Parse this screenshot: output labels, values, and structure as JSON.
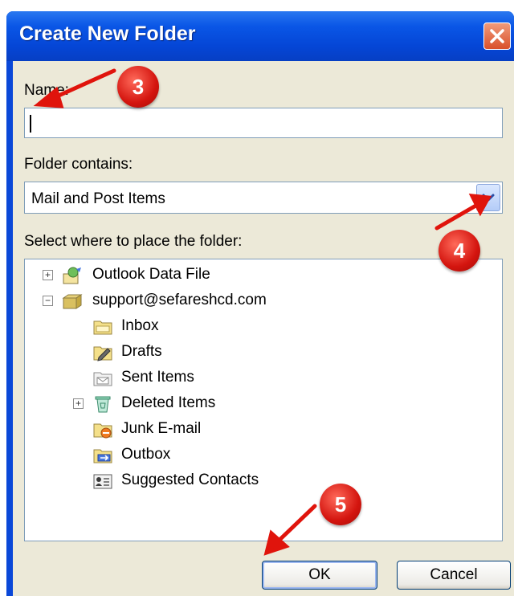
{
  "dialog": {
    "title": "Create New Folder",
    "name_label": "Name:",
    "name_value": "",
    "folder_contains_label": "Folder contains:",
    "folder_contains_value": "Mail and Post Items",
    "select_label": "Select where to place the folder:",
    "tree": {
      "items": [
        {
          "label": "Outlook Data File",
          "icon": "outlook-data-file-icon",
          "expander": "+"
        },
        {
          "label": "support@sefareshcd.com",
          "icon": "mail-account-icon",
          "expander": "−"
        },
        {
          "label": "Inbox",
          "icon": "inbox-folder-icon"
        },
        {
          "label": "Drafts",
          "icon": "drafts-folder-icon"
        },
        {
          "label": "Sent Items",
          "icon": "sent-items-folder-icon"
        },
        {
          "label": "Deleted Items",
          "icon": "deleted-items-folder-icon",
          "expander": "+"
        },
        {
          "label": "Junk E-mail",
          "icon": "junk-email-folder-icon"
        },
        {
          "label": "Outbox",
          "icon": "outbox-folder-icon"
        },
        {
          "label": "Suggested Contacts",
          "icon": "contacts-folder-icon"
        }
      ]
    },
    "ok_label": "OK",
    "cancel_label": "Cancel"
  },
  "annotations": {
    "step3": "3",
    "step4": "4",
    "step5": "5"
  },
  "colors": {
    "titlebar": "#0a56e6",
    "dialog_bg": "#ece9d8",
    "badge": "#d4150f",
    "arrow": "#e0140c"
  }
}
